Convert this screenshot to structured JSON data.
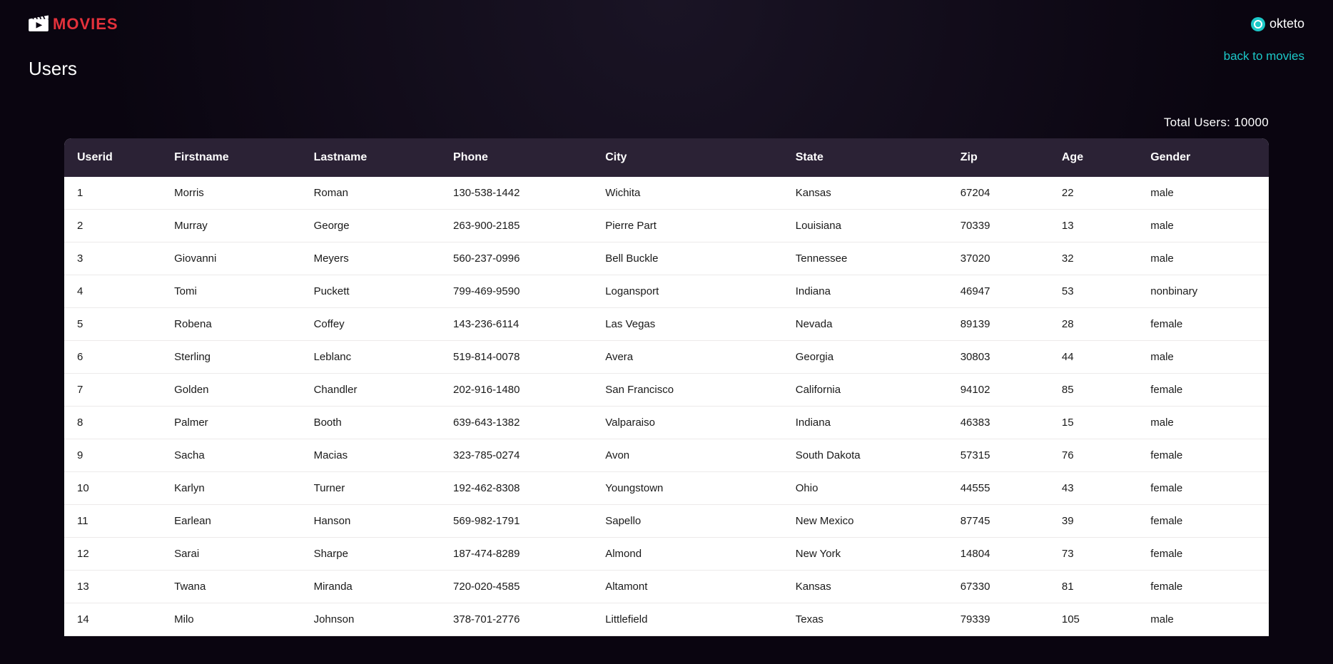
{
  "header": {
    "logo_text": "MOVIES",
    "okteto_text": "okteto"
  },
  "nav": {
    "back_link": "back to movies"
  },
  "page": {
    "title": "Users",
    "total_users_label": "Total Users: 10000"
  },
  "table": {
    "columns": [
      "Userid",
      "Firstname",
      "Lastname",
      "Phone",
      "City",
      "State",
      "Zip",
      "Age",
      "Gender"
    ],
    "rows": [
      {
        "userid": "1",
        "firstname": "Morris",
        "lastname": "Roman",
        "phone": "130-538-1442",
        "city": "Wichita",
        "state": "Kansas",
        "zip": "67204",
        "age": "22",
        "gender": "male"
      },
      {
        "userid": "2",
        "firstname": "Murray",
        "lastname": "George",
        "phone": "263-900-2185",
        "city": "Pierre Part",
        "state": "Louisiana",
        "zip": "70339",
        "age": "13",
        "gender": "male"
      },
      {
        "userid": "3",
        "firstname": "Giovanni",
        "lastname": "Meyers",
        "phone": "560-237-0996",
        "city": "Bell Buckle",
        "state": "Tennessee",
        "zip": "37020",
        "age": "32",
        "gender": "male"
      },
      {
        "userid": "4",
        "firstname": "Tomi",
        "lastname": "Puckett",
        "phone": "799-469-9590",
        "city": "Logansport",
        "state": "Indiana",
        "zip": "46947",
        "age": "53",
        "gender": "nonbinary"
      },
      {
        "userid": "5",
        "firstname": "Robena",
        "lastname": "Coffey",
        "phone": "143-236-6114",
        "city": "Las Vegas",
        "state": "Nevada",
        "zip": "89139",
        "age": "28",
        "gender": "female"
      },
      {
        "userid": "6",
        "firstname": "Sterling",
        "lastname": "Leblanc",
        "phone": "519-814-0078",
        "city": "Avera",
        "state": "Georgia",
        "zip": "30803",
        "age": "44",
        "gender": "male"
      },
      {
        "userid": "7",
        "firstname": "Golden",
        "lastname": "Chandler",
        "phone": "202-916-1480",
        "city": "San Francisco",
        "state": "California",
        "zip": "94102",
        "age": "85",
        "gender": "female"
      },
      {
        "userid": "8",
        "firstname": "Palmer",
        "lastname": "Booth",
        "phone": "639-643-1382",
        "city": "Valparaiso",
        "state": "Indiana",
        "zip": "46383",
        "age": "15",
        "gender": "male"
      },
      {
        "userid": "9",
        "firstname": "Sacha",
        "lastname": "Macias",
        "phone": "323-785-0274",
        "city": "Avon",
        "state": "South Dakota",
        "zip": "57315",
        "age": "76",
        "gender": "female"
      },
      {
        "userid": "10",
        "firstname": "Karlyn",
        "lastname": "Turner",
        "phone": "192-462-8308",
        "city": "Youngstown",
        "state": "Ohio",
        "zip": "44555",
        "age": "43",
        "gender": "female"
      },
      {
        "userid": "11",
        "firstname": "Earlean",
        "lastname": "Hanson",
        "phone": "569-982-1791",
        "city": "Sapello",
        "state": "New Mexico",
        "zip": "87745",
        "age": "39",
        "gender": "female"
      },
      {
        "userid": "12",
        "firstname": "Sarai",
        "lastname": "Sharpe",
        "phone": "187-474-8289",
        "city": "Almond",
        "state": "New York",
        "zip": "14804",
        "age": "73",
        "gender": "female"
      },
      {
        "userid": "13",
        "firstname": "Twana",
        "lastname": "Miranda",
        "phone": "720-020-4585",
        "city": "Altamont",
        "state": "Kansas",
        "zip": "67330",
        "age": "81",
        "gender": "female"
      },
      {
        "userid": "14",
        "firstname": "Milo",
        "lastname": "Johnson",
        "phone": "378-701-2776",
        "city": "Littlefield",
        "state": "Texas",
        "zip": "79339",
        "age": "105",
        "gender": "male"
      }
    ]
  }
}
